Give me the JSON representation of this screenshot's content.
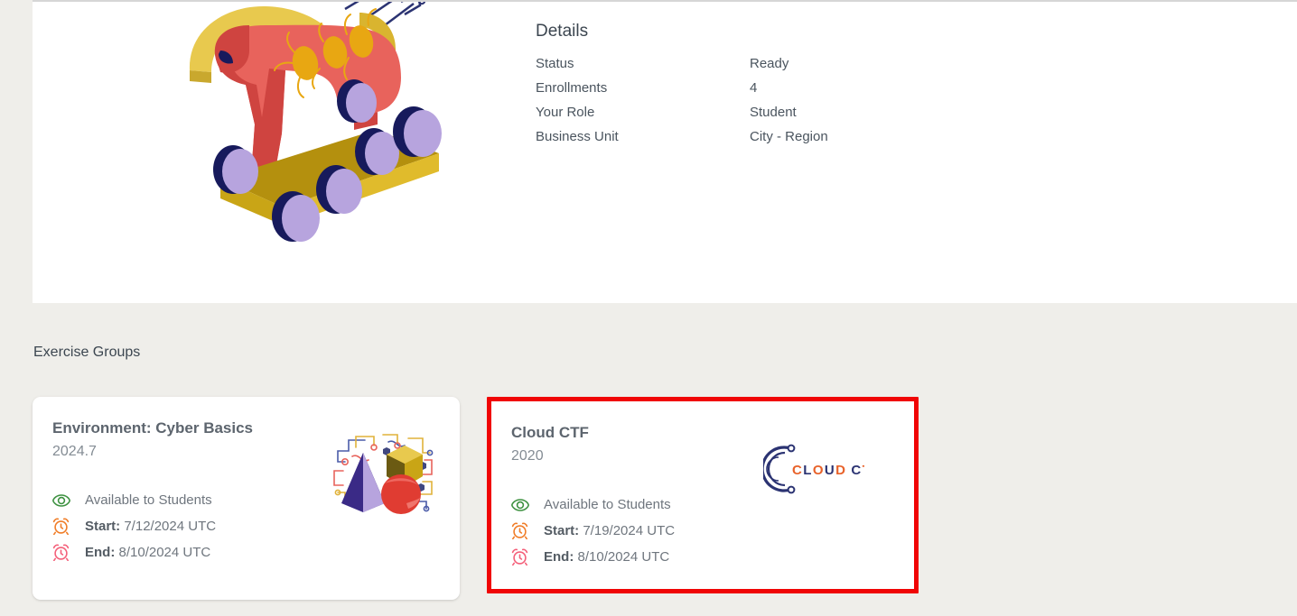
{
  "details": {
    "title": "Details",
    "rows": [
      {
        "key": "Status",
        "value": "Ready"
      },
      {
        "key": "Enrollments",
        "value": "4"
      },
      {
        "key": "Your Role",
        "value": "Student"
      },
      {
        "key": "Business Unit",
        "value": "City - Region"
      }
    ]
  },
  "hero": {
    "illustration": "trojan-horse-illustration"
  },
  "exercise_groups": {
    "heading": "Exercise Groups",
    "cards": [
      {
        "title": "Environment: Cyber Basics",
        "version": "2024.7",
        "availability": "Available to Students",
        "start_label": "Start:",
        "start_value": "7/12/2024 UTC",
        "end_label": "End:",
        "end_value": "8/10/2024 UTC",
        "artwork": "shapes-circuit-illustration",
        "highlighted": false
      },
      {
        "title": "Cloud CTF",
        "version": "2020",
        "availability": "Available to Students",
        "start_label": "Start:",
        "start_value": "7/19/2024 UTC",
        "end_label": "End:",
        "end_value": "8/10/2024 UTC",
        "artwork": "cloud-ctf-logo",
        "logo_text_cloud": "CLOUD",
        "logo_text_ctf": "CTF",
        "highlighted": true
      }
    ]
  },
  "colors": {
    "page_background": "#efeeea",
    "panel_background": "#ffffff",
    "heading_text": "#3c4650",
    "body_text": "#6f767e",
    "highlight_border": "#f00505",
    "eye_icon": "#3d9140",
    "start_clock_icon": "#f07d28",
    "end_clock_icon": "#f4607a",
    "logo_navy": "#2b3372",
    "logo_orange": "#e8622a"
  }
}
